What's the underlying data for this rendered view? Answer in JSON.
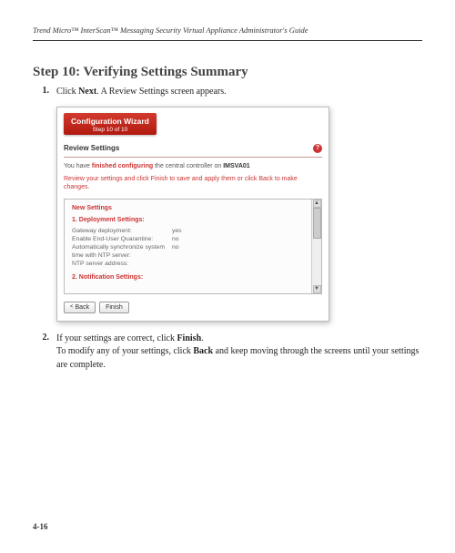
{
  "header": {
    "running_title": "Trend Micro™ InterScan™ Messaging Security Virtual Appliance Administrator's Guide"
  },
  "title": "Step 10: Verifying Settings Summary",
  "steps": {
    "s1": {
      "num": "1.",
      "pre": "Click ",
      "bold": "Next",
      "post": ". A Review Settings screen appears."
    },
    "s2": {
      "num": "2.",
      "pre": "If your settings are correct, click ",
      "bold": "Finish",
      "post": ".",
      "line2_pre": "To modify any of your settings, click ",
      "line2_bold": "Back",
      "line2_post": " and keep moving through the screens until your settings are complete."
    }
  },
  "screenshot": {
    "wizard": {
      "title": "Configuration Wizard",
      "subtitle": "Step 10 of 10"
    },
    "panel_title": "Review Settings",
    "help_glyph": "?",
    "intro": {
      "a": "You have ",
      "b": "finished configuring",
      "c": " the central controller on ",
      "d": "IMSVA01"
    },
    "intro2": "Review your settings and click Finish to save and apply them or click Back to make changes.",
    "new_settings_label": "New Settings",
    "sec1_label": "1. Deployment Settings:",
    "rows": [
      {
        "k": "Gateway deployment:",
        "v": "yes"
      },
      {
        "k": "Enable End-User Quarantine:",
        "v": "no"
      },
      {
        "k": "Automatically synchronize system time with NTP server:",
        "v": "no"
      },
      {
        "k": "NTP server address:",
        "v": ""
      }
    ],
    "sec2_label": "2. Notification Settings:",
    "scroll": {
      "up": "▲",
      "down": "▼"
    },
    "buttons": {
      "back": "Back",
      "back_chev": "<",
      "finish": "Finish"
    }
  },
  "page_number": "4-16"
}
